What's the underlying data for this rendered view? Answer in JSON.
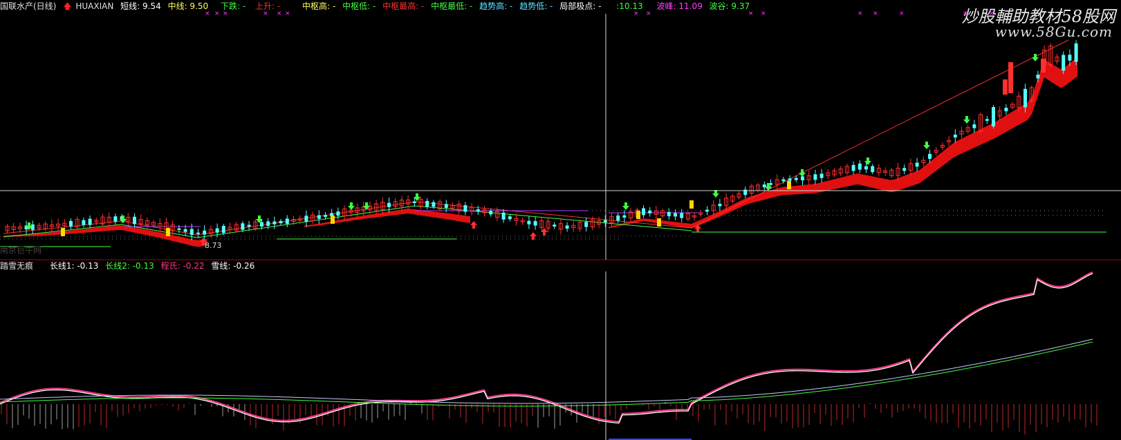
{
  "colors": {
    "background": "#000000",
    "up": "#ff3030",
    "down": "#55ffff",
    "ribbon": "#e01010",
    "green": "#40ff40",
    "pink": "#ff3c8c",
    "white_line": "#ffffff",
    "magenta": "#ff40ff",
    "yellow": "#ffd700"
  },
  "header": {
    "stock_name": "国联水产(日线)",
    "indicator_name": "HUAXIAN",
    "items": [
      {
        "label": "短线: 9.54",
        "color": "#ffffff"
      },
      {
        "label": "中线: 9.50",
        "color": "#ffff60"
      },
      {
        "label": "下跌: -",
        "color": "#40ff40"
      },
      {
        "label": "上升: -",
        "color": "#ff3030"
      },
      {
        "label": "中枢高: -",
        "color": "#ffff60"
      },
      {
        "label": "中枢低: -",
        "color": "#40ff40"
      },
      {
        "label": "中枢最高: -",
        "color": "#ff3030"
      },
      {
        "label": "中枢最低: -",
        "color": "#40ff40"
      },
      {
        "label": "趋势高: -",
        "color": "#60e0ff"
      },
      {
        "label": "趋势低: -",
        "color": "#60e0ff"
      },
      {
        "label": "局部极点: -",
        "color": "#ffffff"
      },
      {
        "label": ":10.13",
        "color": "#40ff40"
      },
      {
        "label": "波峰: 11.09",
        "color": "#ff40ff"
      },
      {
        "label": "波谷: 9.37",
        "color": "#40ff40"
      }
    ]
  },
  "watermark": {
    "line1": "炒股輔助教材58股网",
    "line2": "www.58Gu.com"
  },
  "main_chart": {
    "low_label": "8.73",
    "faint_label": "南京巨牛网"
  },
  "sub_panel": {
    "title": "踏雪无痕",
    "items": [
      {
        "label": "长线1: -0.13",
        "color": "#ffffff"
      },
      {
        "label": "长线2: -0.13",
        "color": "#40ff40"
      },
      {
        "label": "程氏: -0.22",
        "color": "#ff3c8c"
      },
      {
        "label": "雪线: -0.26",
        "color": "#ffffff"
      }
    ]
  }
}
